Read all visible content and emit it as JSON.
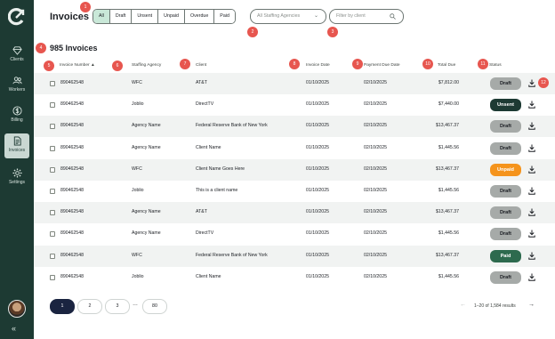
{
  "sidebar": {
    "items": [
      {
        "label": "Clients",
        "icon": "gem-icon"
      },
      {
        "label": "Workers",
        "icon": "people-icon"
      },
      {
        "label": "Billing",
        "icon": "dollar-icon"
      },
      {
        "label": "Invoices",
        "icon": "document-icon"
      },
      {
        "label": "Settings",
        "icon": "gear-icon"
      }
    ],
    "collapse": "«"
  },
  "header": {
    "title": "Invoices",
    "status_filters": [
      "All",
      "Draft",
      "Unsent",
      "Unpaid",
      "Overdue",
      "Paid"
    ],
    "active_filter": "All",
    "agency_placeholder": "All Staffing Agencies",
    "client_placeholder": "Filter by client"
  },
  "count_title": "985 Invoices",
  "markers": [
    "1",
    "2",
    "3",
    "4",
    "5",
    "6",
    "7",
    "8",
    "9",
    "10",
    "11",
    "12"
  ],
  "columns": [
    "Invoice Number",
    "Staffing Agency",
    "Client",
    "Invoice Date",
    "Payment Due Date",
    "Total Due",
    "Status"
  ],
  "sort_indicator": "▲",
  "rows": [
    {
      "number": "890462548",
      "agency": "WFC",
      "client": "AT&T",
      "invoice_date": "01/10/2025",
      "due_date": "02/10/2025",
      "total": "$7,812.00",
      "status": "Draft"
    },
    {
      "number": "890462548",
      "agency": "Joblio",
      "client": "DirectTV",
      "invoice_date": "01/10/2025",
      "due_date": "02/10/2025",
      "total": "$7,440.00",
      "status": "Unsent"
    },
    {
      "number": "890462548",
      "agency": "Agency Name",
      "client": "Federal Reserve Bank of New York",
      "invoice_date": "01/10/2025",
      "due_date": "02/10/2025",
      "total": "$13,467.37",
      "status": "Draft"
    },
    {
      "number": "890462548",
      "agency": "Agency Name",
      "client": "Client Name",
      "invoice_date": "01/10/2025",
      "due_date": "02/10/2025",
      "total": "$1,445.56",
      "status": "Draft"
    },
    {
      "number": "890462548",
      "agency": "WFC",
      "client": "Client Name Goes Here",
      "invoice_date": "01/10/2025",
      "due_date": "02/10/2025",
      "total": "$13,467.37",
      "status": "Unpaid"
    },
    {
      "number": "890462548",
      "agency": "Joblio",
      "client": "This is a client name",
      "invoice_date": "01/10/2025",
      "due_date": "02/10/2025",
      "total": "$1,445.56",
      "status": "Draft"
    },
    {
      "number": "890462548",
      "agency": "Agency Name",
      "client": "AT&T",
      "invoice_date": "01/10/2025",
      "due_date": "02/10/2025",
      "total": "$13,467.37",
      "status": "Draft"
    },
    {
      "number": "890462548",
      "agency": "Agency Name",
      "client": "DirectTV",
      "invoice_date": "01/10/2025",
      "due_date": "02/10/2025",
      "total": "$1,445.56",
      "status": "Draft"
    },
    {
      "number": "890462548",
      "agency": "WFC",
      "client": "Federal Reserve Bank of New York",
      "invoice_date": "01/10/2025",
      "due_date": "02/10/2025",
      "total": "$13,467.37",
      "status": "Paid"
    },
    {
      "number": "890462548",
      "agency": "Joblio",
      "client": "Client Name",
      "invoice_date": "01/10/2025",
      "due_date": "02/10/2025",
      "total": "$1,445.56",
      "status": "Draft"
    }
  ],
  "pagination": {
    "pages": [
      "1",
      "2",
      "3",
      "80"
    ],
    "active_page": "1",
    "ellipsis": "…",
    "results": "1–20 of 1,584 results",
    "prev": "←",
    "next": "→"
  },
  "colors": {
    "sidebar": "#1d3a33",
    "active_filter": "#c9e8d8",
    "draft": "#a6aaa8",
    "unsent": "#1d3a33",
    "unpaid": "#f5941d",
    "paid": "#2d6a4e",
    "marker": "#e7564f",
    "active_page": "#1a2440"
  }
}
